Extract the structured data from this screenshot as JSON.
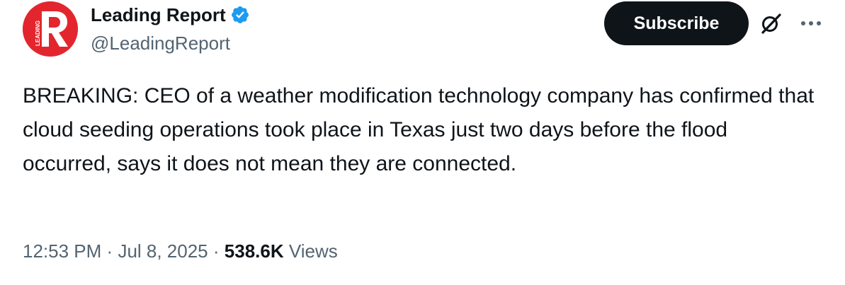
{
  "author": {
    "display_name": "Leading Report",
    "handle": "@LeadingReport",
    "avatar_icon": "leading-report-logo",
    "avatar_color": "#e3262e",
    "verified": true,
    "verified_color": "#1d9bf0"
  },
  "actions": {
    "subscribe_label": "Subscribe",
    "grok_icon": "grok-icon",
    "more_icon": "more-options-icon"
  },
  "post": {
    "text": "BREAKING: CEO of a weather modification technology company has confirmed that cloud seeding operations took place in Texas just two days before the flood occurred, says it does not mean they are connected."
  },
  "meta": {
    "time": "12:53 PM",
    "separator": "·",
    "date": "Jul 8, 2025",
    "views_count": "538.6K",
    "views_label": "Views"
  }
}
